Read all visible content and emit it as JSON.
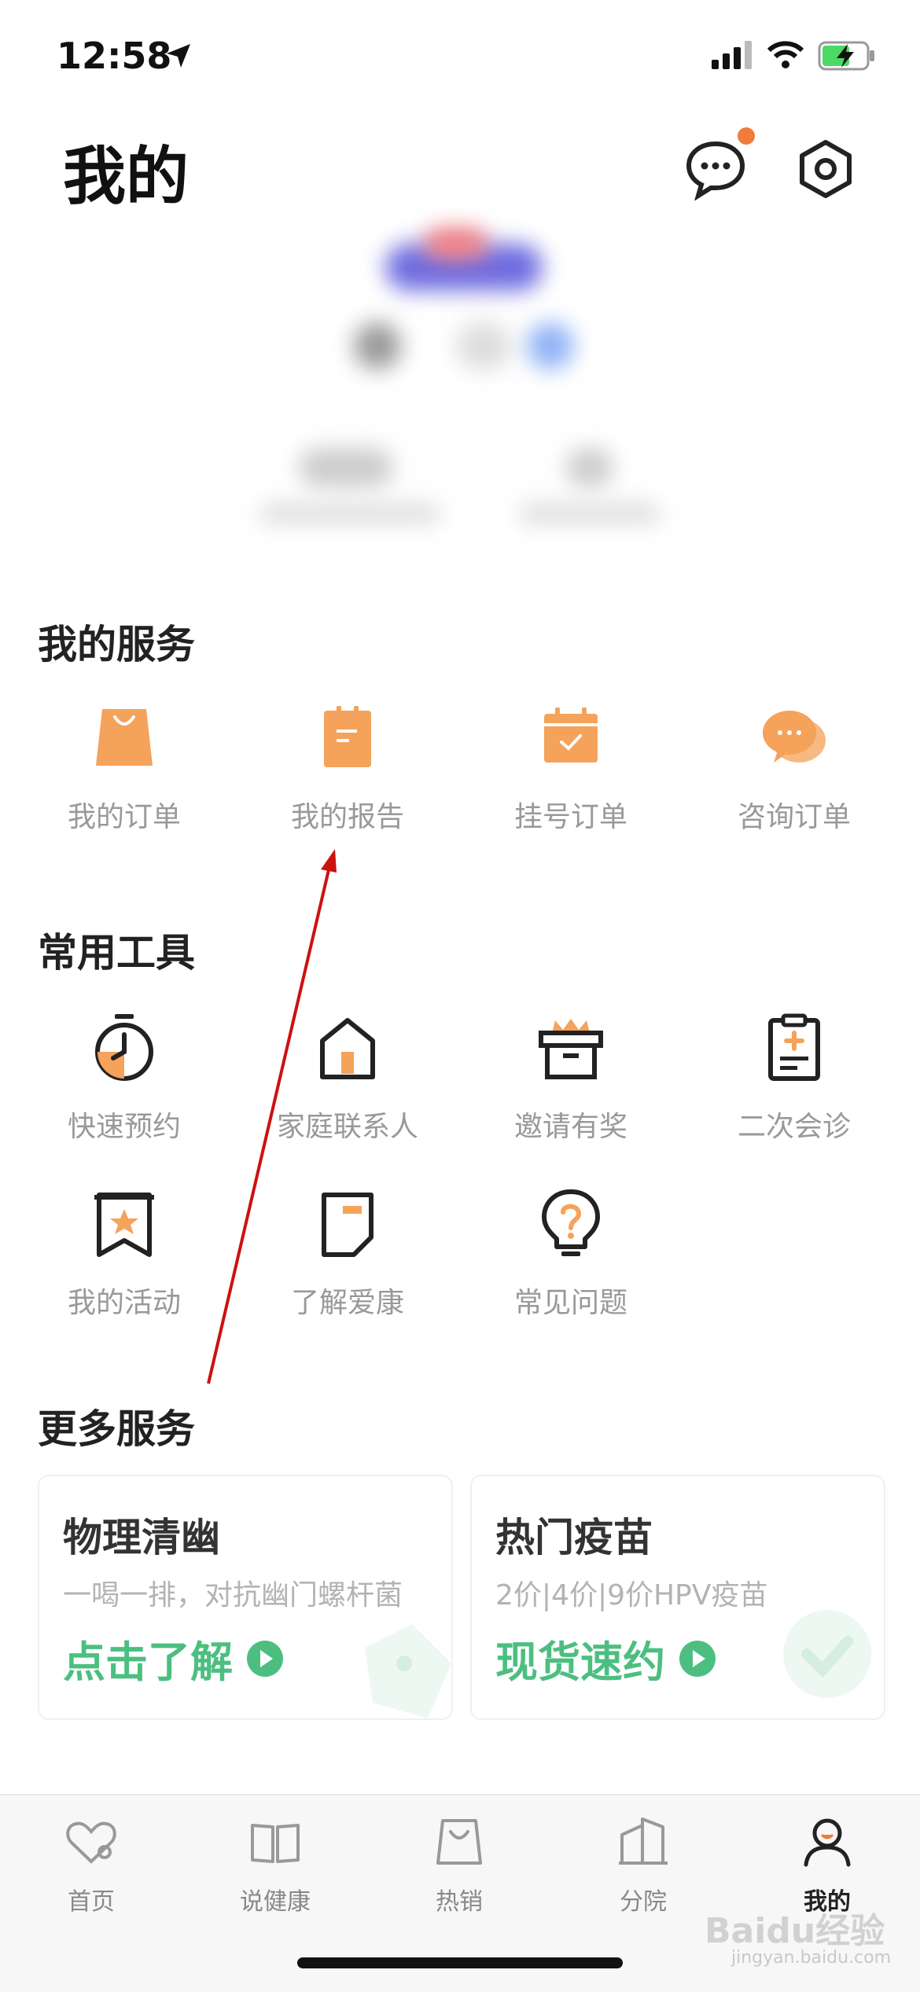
{
  "status_bar": {
    "time": "12:58",
    "location-icon": "location-arrow-icon"
  },
  "header": {
    "title": "我的",
    "message_icon": "chat-bubble-icon",
    "settings_icon": "hexagon-gear-icon"
  },
  "services": {
    "title": "我的服务",
    "items": [
      {
        "label": "我的订单",
        "icon": "shopping-bag-icon"
      },
      {
        "label": "我的报告",
        "icon": "clipboard-report-icon"
      },
      {
        "label": "挂号订单",
        "icon": "calendar-check-icon"
      },
      {
        "label": "咨询订单",
        "icon": "chat-consult-icon"
      }
    ]
  },
  "tools": {
    "title": "常用工具",
    "items": [
      {
        "label": "快速预约",
        "icon": "timer-icon"
      },
      {
        "label": "家庭联系人",
        "icon": "house-icon"
      },
      {
        "label": "邀请有奖",
        "icon": "gift-box-icon"
      },
      {
        "label": "二次会诊",
        "icon": "medical-clipboard-icon"
      },
      {
        "label": "我的活动",
        "icon": "star-banner-icon"
      },
      {
        "label": "了解爱康",
        "icon": "bookmark-card-icon"
      },
      {
        "label": "常见问题",
        "icon": "lightbulb-question-icon"
      }
    ]
  },
  "more": {
    "title": "更多服务",
    "cards": [
      {
        "title": "物理清幽",
        "subtitle": "一喝一排，对抗幽门螺杆菌",
        "cta": "点击了解"
      },
      {
        "title": "热门疫苗",
        "subtitle": "2价|4价|9价HPV疫苗",
        "cta": "现货速约"
      }
    ]
  },
  "tabbar": {
    "items": [
      {
        "label": "首页",
        "icon": "heart-home-icon",
        "active": false
      },
      {
        "label": "说健康",
        "icon": "open-book-icon",
        "active": false
      },
      {
        "label": "热销",
        "icon": "shopping-bag-outline-icon",
        "active": false
      },
      {
        "label": "分院",
        "icon": "building-icon",
        "active": false
      },
      {
        "label": "我的",
        "icon": "user-avatar-icon",
        "active": true
      }
    ]
  },
  "watermark": {
    "text": "Baidu经验",
    "sub": "jingyan.baidu.com"
  },
  "colors": {
    "accent": "#f5a25a",
    "green": "#4cbf80",
    "annotation": "#cc1111"
  }
}
